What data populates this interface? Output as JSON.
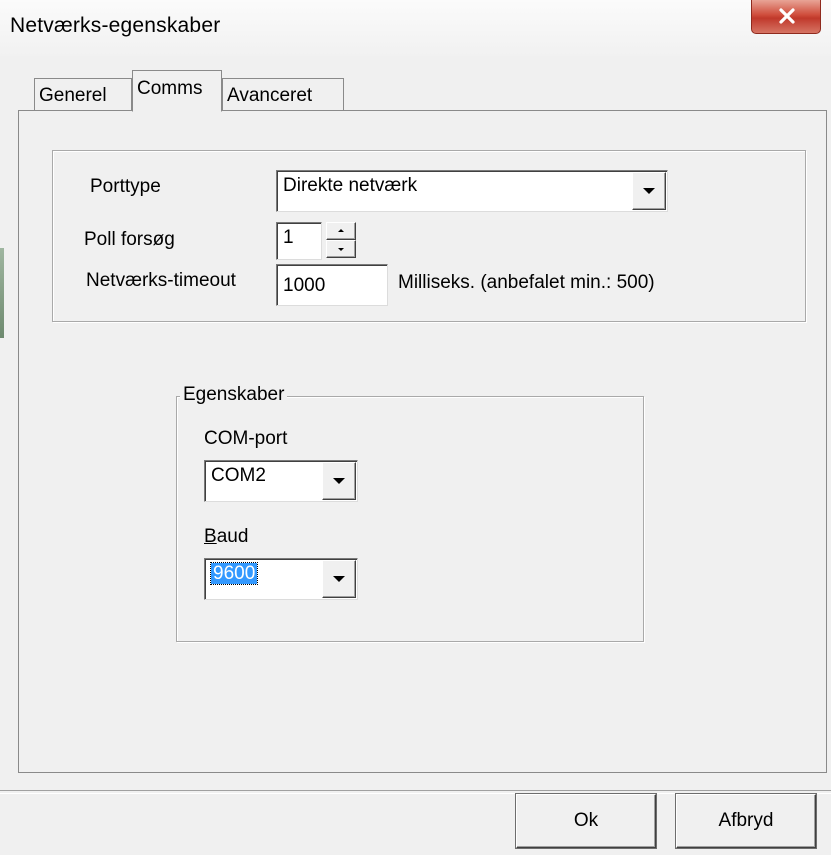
{
  "window": {
    "title": "Netværks-egenskaber",
    "close_glyph": "✕"
  },
  "tabs": [
    {
      "label": "Generel",
      "active": false
    },
    {
      "label": "Comms",
      "active": true
    },
    {
      "label": "Avanceret",
      "active": false
    }
  ],
  "comms": {
    "porttype_label": "Porttype",
    "porttype_value": "Direkte netværk",
    "poll_label": "Poll forsøg",
    "poll_value": "1",
    "timeout_label": "Netværks-timeout",
    "timeout_value": "1000",
    "timeout_hint": "Milliseks. (anbefalet min.: 500)"
  },
  "properties": {
    "group_title": "Egenskaber",
    "com_port_label": "COM-port",
    "com_port_value": "COM2",
    "baud_label_underlined": "B",
    "baud_label_rest": "aud",
    "baud_value": "9600"
  },
  "buttons": {
    "ok": "Ok",
    "cancel": "Afbryd"
  },
  "colors": {
    "close_button": "#c0392b",
    "selection": "#3399ff",
    "dialog_bg": "#f0f0f0"
  }
}
